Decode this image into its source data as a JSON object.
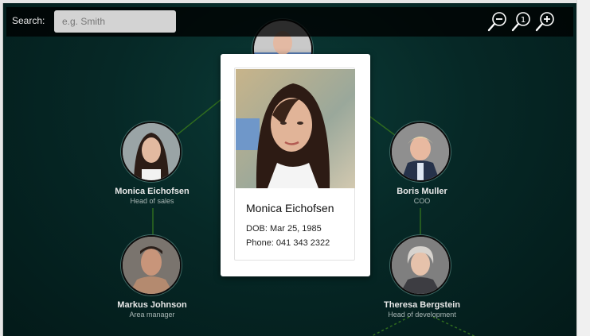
{
  "search": {
    "label": "Search:",
    "placeholder": "e.g. Smith"
  },
  "zoom": {
    "zoom_out_icon": "zoom-out-icon",
    "zoom_reset_icon": "zoom-reset-icon",
    "zoom_reset_text": "1",
    "zoom_in_icon": "zoom-in-icon"
  },
  "people": [
    {
      "id": "top",
      "name": "",
      "role": ""
    },
    {
      "id": "monica",
      "name": "Monica Eichofsen",
      "role": "Head of sales"
    },
    {
      "id": "boris",
      "name": "Boris Muller",
      "role": "COO"
    },
    {
      "id": "markus",
      "name": "Markus Johnson",
      "role": "Area manager"
    },
    {
      "id": "theresa",
      "name": "Theresa Bergstein",
      "role": "Head of development"
    }
  ],
  "popup": {
    "name": "Monica Eichofsen",
    "dob": "DOB: Mar 25, 1985",
    "phone": "Phone: 041 343 2322"
  },
  "colors": {
    "background": "#062826",
    "link": "#2f6b1f",
    "toolbar": "#000000",
    "popup": "#ffffff"
  }
}
